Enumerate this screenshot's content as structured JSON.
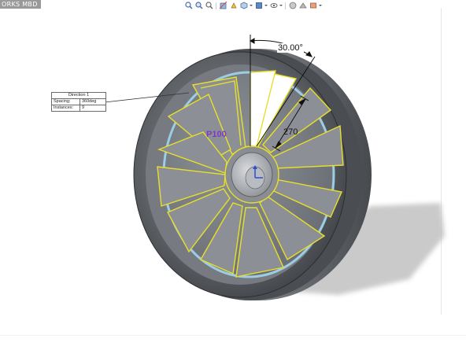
{
  "app": {
    "title_fragment": "ORKS MBD"
  },
  "hud_toolbar": {
    "icons": [
      "zoom-to-fit-icon",
      "zoom-area-icon",
      "previous-view-icon",
      "section-view-icon",
      "dynamic-annotation-icon",
      "view-orientation-icon",
      "display-style-icon",
      "hide-show-items-icon",
      "edit-appearance-icon",
      "apply-scene-icon",
      "view-settings-icon"
    ]
  },
  "pattern_callout": {
    "title": "Direction 1",
    "rows": [
      {
        "key": "Spacing:",
        "value": "360deg"
      },
      {
        "key": "Instances:",
        "value": "9"
      }
    ]
  },
  "dimensions": {
    "angle": "30.00°",
    "length": "270"
  },
  "feature_label": "P100",
  "colors": {
    "accent_yellow": "#e7df2a",
    "feature_label": "#7b39c8",
    "edge_highlight": "#9fd6ef"
  }
}
